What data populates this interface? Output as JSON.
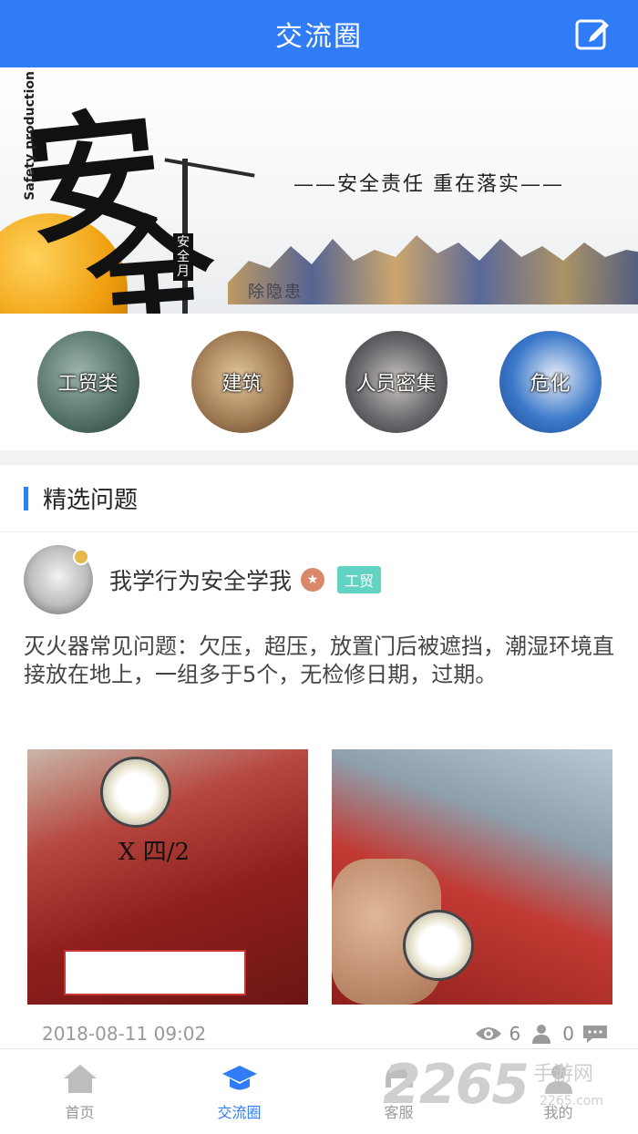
{
  "header": {
    "title": "交流圈",
    "edit_icon": "edit-icon"
  },
  "banner": {
    "big_char_1": "安",
    "big_char_2": "全",
    "english": "Safety production",
    "seal": "安全月",
    "slogan": "——安全责任  重在落实——",
    "sub": "除隐患"
  },
  "categories": [
    {
      "label": "工贸类"
    },
    {
      "label": "建筑"
    },
    {
      "label": "人员密集"
    },
    {
      "label": "危化"
    }
  ],
  "section": {
    "title": "精选问题"
  },
  "post": {
    "author": "我学行为安全学我",
    "tag": "工贸",
    "content": "灭火器常见问题：欠压，超压，放置门后被遮挡，潮湿环境直接放在地上，一组多于5个，无检修日期，过期。",
    "photo1_handwriting": "X 四/2",
    "date": "2018-08-11 09:02",
    "views": "6",
    "likes": "0"
  },
  "tabbar": {
    "items": [
      {
        "label": "首页",
        "icon": "home-icon"
      },
      {
        "label": "交流圈",
        "icon": "graduation-cap-icon"
      },
      {
        "label": "客服",
        "icon": "service-icon"
      },
      {
        "label": "我的",
        "icon": "user-icon"
      }
    ]
  },
  "watermark": {
    "number": "2265",
    "text": "手游网",
    "url": "2265.com"
  },
  "colors": {
    "primary": "#2f7cf6",
    "tag": "#62d3c3"
  }
}
